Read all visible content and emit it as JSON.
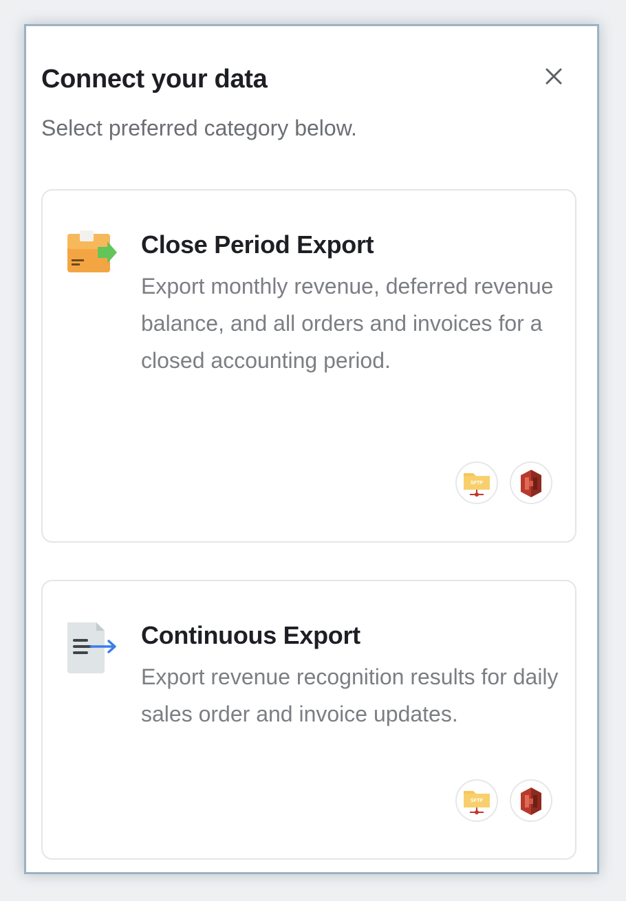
{
  "dialog": {
    "title": "Connect your data",
    "subtitle": "Select preferred category below.",
    "close_icon": "close-icon"
  },
  "categories": [
    {
      "title": "Close Period Export",
      "description": "Export monthly revenue, deferred revenue balance, and all orders and invoices for a closed accounting period.",
      "icon": "folder-export-icon",
      "destinations": [
        {
          "icon": "sftp-folder-icon",
          "label": "SFTP"
        },
        {
          "icon": "amazon-s3-icon"
        }
      ]
    },
    {
      "title": "Continuous Export",
      "description": "Export revenue recognition results for daily sales order and invoice updates.",
      "icon": "document-export-icon",
      "destinations": [
        {
          "icon": "sftp-folder-icon",
          "label": "SFTP"
        },
        {
          "icon": "amazon-s3-icon"
        }
      ]
    }
  ],
  "colors": {
    "border_accent": "#9db1c3",
    "folder_orange": "#f4a543",
    "export_green": "#63c45a",
    "arrow_blue": "#3b7ee5",
    "s3_red": "#b83a2c",
    "sftp_yellow": "#f6c75a"
  }
}
